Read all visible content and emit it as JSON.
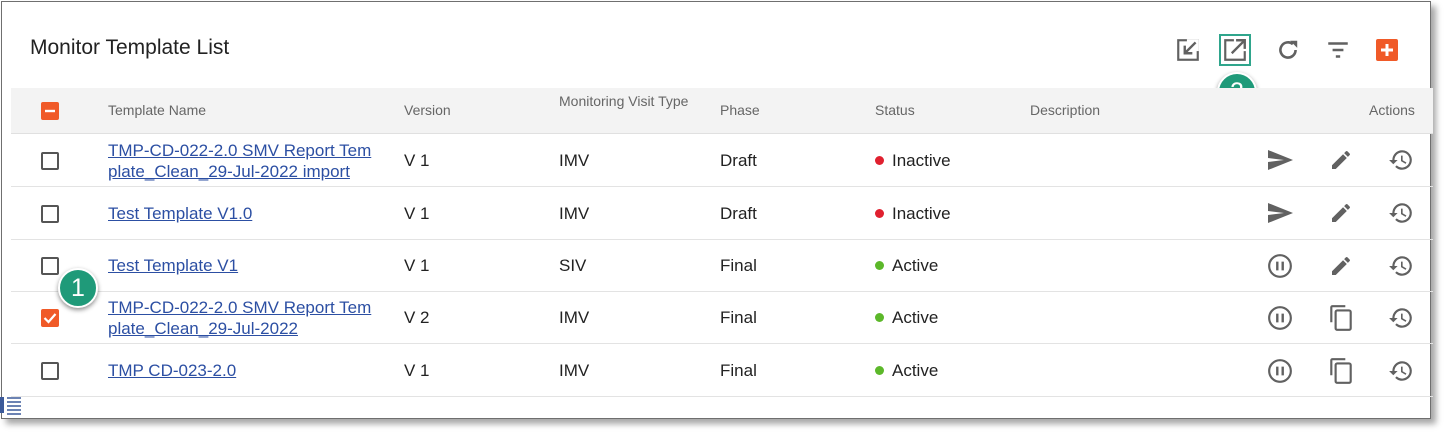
{
  "page": {
    "title": "Monitor Template List"
  },
  "toolbar": [
    {
      "name": "import-icon"
    },
    {
      "name": "export-icon",
      "highlighted": true
    },
    {
      "name": "refresh-icon"
    },
    {
      "name": "filter-icon"
    },
    {
      "name": "add-icon"
    }
  ],
  "callouts": {
    "one": "1",
    "two": "2"
  },
  "columns": {
    "name": "Template Name",
    "version": "Version",
    "visit_type": "Monitoring Visit Type",
    "phase": "Phase",
    "status": "Status",
    "description": "Description",
    "actions": "Actions"
  },
  "rows": [
    {
      "name": "TMP-CD-022-2.0 SMV Report Template_Clean_29-Jul-2022 import",
      "name_lines": [
        "TMP-CD-022-2.0 SMV Report Tem",
        "plate_Clean_29-Jul-2022 import"
      ],
      "version": "V 1",
      "visit_type": "IMV",
      "phase": "Draft",
      "status": "Inactive",
      "checked": false,
      "actions": [
        "send-icon",
        "edit-icon",
        "history-icon"
      ]
    },
    {
      "name": "Test Template V1.0",
      "name_lines": [
        "Test Template V1.0"
      ],
      "version": "V 1",
      "visit_type": "IMV",
      "phase": "Draft",
      "status": "Inactive",
      "checked": false,
      "actions": [
        "send-icon",
        "edit-icon",
        "history-icon"
      ]
    },
    {
      "name": "Test Template V1",
      "name_lines": [
        "Test Template V1"
      ],
      "version": "V 1",
      "visit_type": "SIV",
      "phase": "Final",
      "status": "Active",
      "checked": false,
      "actions": [
        "pause-icon",
        "edit-icon",
        "history-icon"
      ]
    },
    {
      "name": "TMP-CD-022-2.0 SMV Report Template_Clean_29-Jul-2022",
      "name_lines": [
        "TMP-CD-022-2.0 SMV Report Tem",
        "plate_Clean_29-Jul-2022"
      ],
      "version": "V 2",
      "visit_type": "IMV",
      "phase": "Final",
      "status": "Active",
      "checked": true,
      "actions": [
        "pause-icon",
        "copy-icon",
        "history-icon"
      ]
    },
    {
      "name": "TMP CD-023-2.0",
      "name_lines": [
        "TMP CD-023-2.0"
      ],
      "version": "V 1",
      "visit_type": "IMV",
      "phase": "Final",
      "status": "Active",
      "checked": false,
      "actions": [
        "pause-icon",
        "copy-icon",
        "history-icon"
      ]
    }
  ],
  "colors": {
    "accent": "#f05a28",
    "callout": "#1f9a79",
    "highlight_border": "#2fa58c",
    "inactive": "#e0202f",
    "active": "#5cb82a",
    "link": "#2c4fa3",
    "icon": "#616161"
  }
}
